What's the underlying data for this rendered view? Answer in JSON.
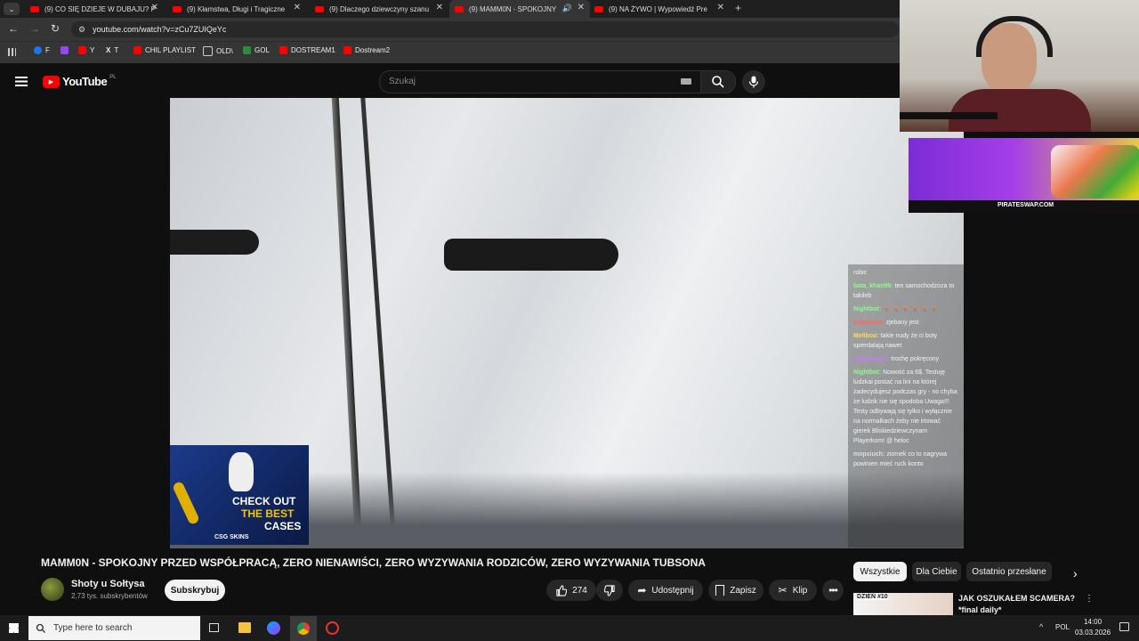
{
  "browser": {
    "tabs": [
      {
        "label": "(9) CO SIĘ DZIEJE W DUBAJU? P"
      },
      {
        "label": "(9) Kłamstwa, Długi i Tragiczne"
      },
      {
        "label": "(9) Dlaczego dziewczyny szanu"
      },
      {
        "label": "(9) MAMM0N - SPOKOJNY"
      },
      {
        "label": "(9) NA ŻYWO | Wypowiedź Pre"
      }
    ],
    "url": "youtube.com/watch?v=zCu7ZUIQeYc",
    "bookmarks": [
      {
        "label": "F"
      },
      {
        "label": "Y"
      },
      {
        "label": "T"
      },
      {
        "label": "CHIL PLAYLIST"
      },
      {
        "label": "OLD\\"
      },
      {
        "label": "GOL"
      },
      {
        "label": "DOSTREAM1"
      },
      {
        "label": "Dostream2"
      }
    ]
  },
  "youtube": {
    "logo": "YouTube",
    "region": "PL",
    "search_placeholder": "Szukaj"
  },
  "video": {
    "ad_line1": "CHECK OUT",
    "ad_line2": "THE BEST",
    "ad_line3": "CASES",
    "ad_brand": "CSG SKINS"
  },
  "overlay": {
    "promo_site": "PIRATESWAP.COM",
    "chat": [
      {
        "user": "",
        "text": "robic"
      },
      {
        "user": "bata_khan99:",
        "text": "ten samochodzoza to takileb"
      },
      {
        "user": "Nightbot:",
        "text": "🦌 🦌 🦌 🦌 🦌 🦌"
      },
      {
        "user": "wigobalip:",
        "text": "zjebany jest"
      },
      {
        "user": "Meliboo:",
        "text": "takie nudy że ci boty spierdalają nawet"
      },
      {
        "user": "alphamalex:",
        "text": "trochę pokręcony"
      },
      {
        "user": "Nightbot:",
        "text": "Nowość za 6$. Testuję ludzkai postać na lini na której żadecydujesz podczas gry - no chyba że ludzik nie się spodoba Uwaga!!! Testy odbywają się tylko i wyłącznie na normalkach żeby nie irtować gierek Bliskiedziewczynam Playerkom! @ heloc"
      },
      {
        "user": "mopsiuch:",
        "text": "ziomek co to nagrywa powinien mieć ruck konto"
      }
    ]
  },
  "below_video": {
    "title": "MAMM0N - SPOKOJNY PRZED WSPÓŁPRACĄ, ZERO NIENAWIŚCI, ZERO WYZYWANIA RODZICÓW, ZERO WYZYWANIA TUBSONA",
    "channel_name": "Shoty u Sołtysa",
    "subscribers": "2,73 tys. subskrybentów",
    "subscribe_label": "Subskrybuj",
    "likes": "274",
    "share_label": "Udostępnij",
    "save_label": "Zapisz",
    "clip_label": "Klip",
    "filter_chips": [
      "Wszystkie",
      "Dla Ciebie",
      "Ostatnio przesłane"
    ],
    "recommended_title": "JAK OSZUKAŁEM SCAMERA? *final daily*",
    "recommended_thumb_text": "DZIEŃ #10"
  },
  "taskbar": {
    "search_placeholder": "Type here to search",
    "language": "POL",
    "time": "14:00",
    "date": "03.03.2026"
  },
  "colors": {
    "yt_red": "#ff0000",
    "bg": "#0f0f0f"
  }
}
